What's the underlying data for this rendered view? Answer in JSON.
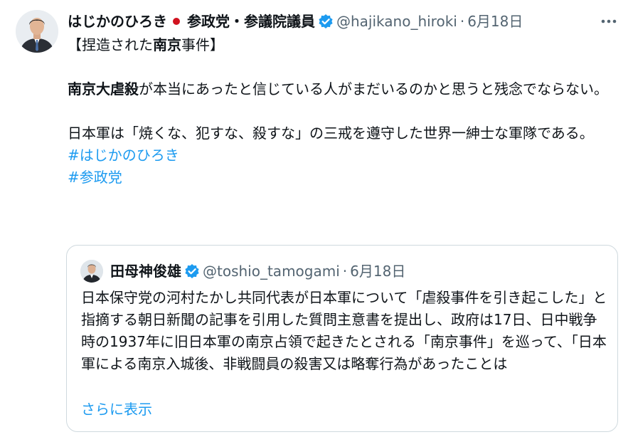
{
  "author": {
    "name": "はじかのひろき",
    "affiliation": "参政党・参議院議員",
    "handle": "@hajikano_hiroki",
    "separator": "·",
    "date": "6月18日",
    "avatar_icon": "person-avatar-icon",
    "flag_icon": "japan-flag-icon",
    "verified_icon": "verified-badge-icon"
  },
  "more_icon": "more-options-icon",
  "tweet": {
    "title_open": "【捏造された",
    "title_bold": "南京",
    "title_close": "事件】",
    "p1_bold": "南京大虐殺",
    "p1_text": "が本当にあったと信じている人がまだいるのかと思うと残念でならない。",
    "p2_text": "日本軍は「焼くな、犯すな、殺すな」の三戒を遵守した世界一紳士な軍隊である。",
    "hashtags": [
      "#はじかのひろき",
      "#参政党"
    ]
  },
  "quote": {
    "name": "田母神俊雄",
    "handle": "@toshio_tamogami",
    "separator": "·",
    "date": "6月18日",
    "avatar_icon": "person-avatar-icon",
    "verified_icon": "verified-badge-icon",
    "text": "日本保守党の河村たかし共同代表が日本軍について「虐殺事件を引き起こした」と指摘する朝日新聞の記事を引用した質問主意書を提出し、政府は17日、日中戦争時の1937年に旧日本軍の南京占領で起きたとされる「南京事件」を巡って、「日本軍による南京入城後、非戦闘員の殺害又は略奪行為があったことは",
    "show_more": "さらに表示"
  },
  "colors": {
    "text": "#0f1419",
    "secondary": "#536471",
    "link": "#1d9bf0",
    "verified": "#1d9bf0",
    "border": "#cfd9de",
    "flag_red": "#d1121f"
  }
}
